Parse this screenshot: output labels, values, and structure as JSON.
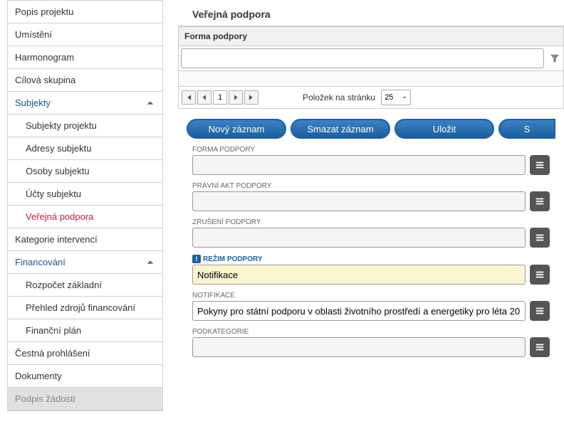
{
  "sidebar": {
    "items": [
      {
        "label": "Popis projektu",
        "type": "item"
      },
      {
        "label": "Umístění",
        "type": "item"
      },
      {
        "label": "Harmonogram",
        "type": "item"
      },
      {
        "label": "Cílová skupina",
        "type": "item"
      },
      {
        "label": "Subjekty",
        "type": "expandable"
      },
      {
        "label": "Subjekty projektu",
        "type": "sub"
      },
      {
        "label": "Adresy subjektu",
        "type": "sub"
      },
      {
        "label": "Osoby subjektu",
        "type": "sub"
      },
      {
        "label": "Účty subjektu",
        "type": "sub"
      },
      {
        "label": "Veřejná podpora",
        "type": "sub-active"
      },
      {
        "label": "Kategorie intervencí",
        "type": "item"
      },
      {
        "label": "Financování",
        "type": "expandable"
      },
      {
        "label": "Rozpočet základní",
        "type": "sub"
      },
      {
        "label": "Přehled zdrojů financování",
        "type": "sub"
      },
      {
        "label": "Finanční plán",
        "type": "sub"
      },
      {
        "label": "Čestná prohlášení",
        "type": "item"
      },
      {
        "label": "Dokumenty",
        "type": "item"
      },
      {
        "label": "Podpis žádosti",
        "type": "disabled"
      }
    ]
  },
  "section": {
    "title": "Veřejná podpora"
  },
  "table": {
    "header": "Forma podpory"
  },
  "pager": {
    "page": "1",
    "perPageLabel": "Položek na stránku",
    "perPageValue": "25"
  },
  "buttons": {
    "new": "Nový záznam",
    "delete": "Smazat záznam",
    "save": "Uložit",
    "partial": "S"
  },
  "form": {
    "formaPodpory": {
      "label": "FORMA PODPORY",
      "value": ""
    },
    "pravniAkt": {
      "label": "PRÁVNÍ AKT PODPORY",
      "value": ""
    },
    "zruseni": {
      "label": "ZRUŠENÍ PODPORY",
      "value": ""
    },
    "rezim": {
      "label": "REŽIM PODPORY",
      "value": "Notifikace"
    },
    "notifikace": {
      "label": "NOTIFIKACE",
      "value": "Pokyny pro státní podporu v oblasti životního prostředí a energetiky pro léta 20"
    },
    "podkategorie": {
      "label": "PODKATEGORIE",
      "value": ""
    }
  }
}
